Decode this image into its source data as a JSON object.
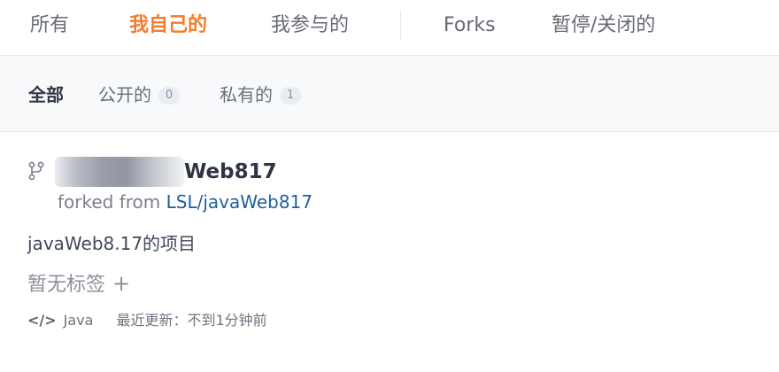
{
  "tabs": {
    "all": "所有",
    "mine": "我自己的",
    "participated": "我参与的",
    "forks": "Forks",
    "paused_closed": "暂停/关闭的"
  },
  "filters": {
    "all": "全部",
    "public_label": "公开的",
    "public_count": "0",
    "private_label": "私有的",
    "private_count": "1"
  },
  "repo": {
    "name_visible": "Web817",
    "forked_prefix": "forked from",
    "forked_source": "LSL/javaWeb817",
    "description": "javaWeb8.17的项目",
    "no_tags": "暂无标签",
    "add_tag": "+",
    "language": "Java",
    "updated": "最近更新：不到1分钟前",
    "code_icon": "</>"
  },
  "colors": {
    "active_tab": "#f57c2c",
    "link": "#1f5f9a"
  }
}
